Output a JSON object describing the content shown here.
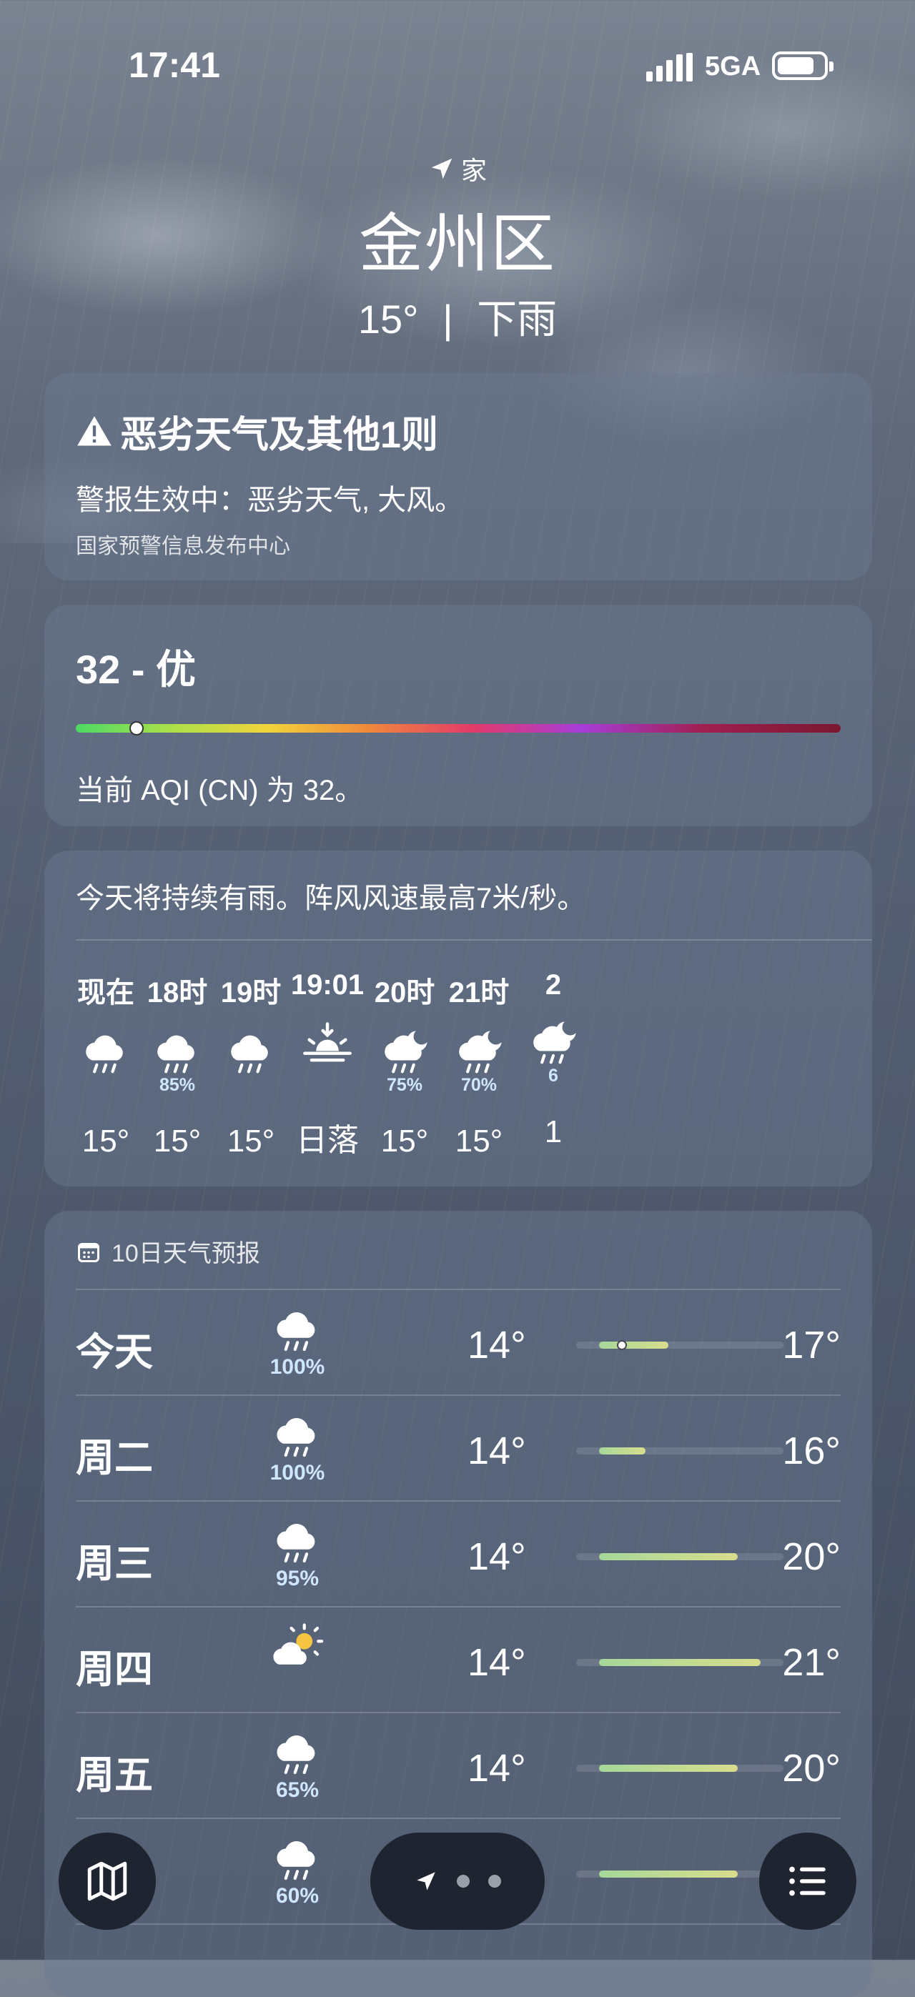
{
  "status_bar": {
    "time": "17:41",
    "network": "5GA"
  },
  "header": {
    "location_label": "家",
    "city": "金州区",
    "temp": "15°",
    "condition": "下雨"
  },
  "alert": {
    "title": "恶劣天气及其他1则",
    "body": "警报生效中：恶劣天气, 大风。",
    "source": "国家预警信息发布中心"
  },
  "aqi": {
    "value_label": "32 - 优",
    "description": "当前 AQI (CN) 为 32。",
    "level_fraction": 0.07
  },
  "hourly": {
    "summary": "今天将持续有雨。阵风风速最高7米/秒。",
    "items": [
      {
        "label": "现在",
        "icon": "rain-cloud-icon",
        "pct": "",
        "temp": "15°"
      },
      {
        "label": "18时",
        "icon": "rain-cloud-icon",
        "pct": "85%",
        "temp": "15°"
      },
      {
        "label": "19时",
        "icon": "rain-cloud-icon",
        "pct": "",
        "temp": "15°"
      },
      {
        "label": "19:01",
        "icon": "sunset-icon",
        "pct": "",
        "temp": "日落"
      },
      {
        "label": "20时",
        "icon": "night-rain-icon",
        "pct": "75%",
        "temp": "15°"
      },
      {
        "label": "21时",
        "icon": "night-rain-icon",
        "pct": "70%",
        "temp": "15°"
      },
      {
        "label": "2",
        "icon": "night-rain-icon",
        "pct": "6",
        "temp": "1"
      }
    ]
  },
  "daily": {
    "title": "10日天气预报",
    "rows": [
      {
        "day": "今天",
        "icon": "rain-cloud-icon",
        "pct": "100%",
        "low": "14°",
        "high": "17°",
        "range_low": 14,
        "range_high": 17,
        "current": 15
      },
      {
        "day": "周二",
        "icon": "rain-cloud-icon",
        "pct": "100%",
        "low": "14°",
        "high": "16°",
        "range_low": 14,
        "range_high": 16,
        "current": null
      },
      {
        "day": "周三",
        "icon": "rain-cloud-icon",
        "pct": "95%",
        "low": "14°",
        "high": "20°",
        "range_low": 14,
        "range_high": 20,
        "current": null
      },
      {
        "day": "周四",
        "icon": "partly-sunny-icon",
        "pct": "",
        "low": "14°",
        "high": "21°",
        "range_low": 14,
        "range_high": 21,
        "current": null
      },
      {
        "day": "周五",
        "icon": "rain-cloud-icon",
        "pct": "65%",
        "low": "14°",
        "high": "20°",
        "range_low": 14,
        "range_high": 20,
        "current": null
      },
      {
        "day": "",
        "icon": "rain-cloud-icon",
        "pct": "60%",
        "low": "",
        "high": "",
        "range_low": 14,
        "range_high": 20,
        "current": null
      }
    ]
  },
  "colors": {
    "card_bg": "#6c7a92",
    "bar_start": "#a6d89a",
    "bar_end": "#d8dd8c"
  }
}
